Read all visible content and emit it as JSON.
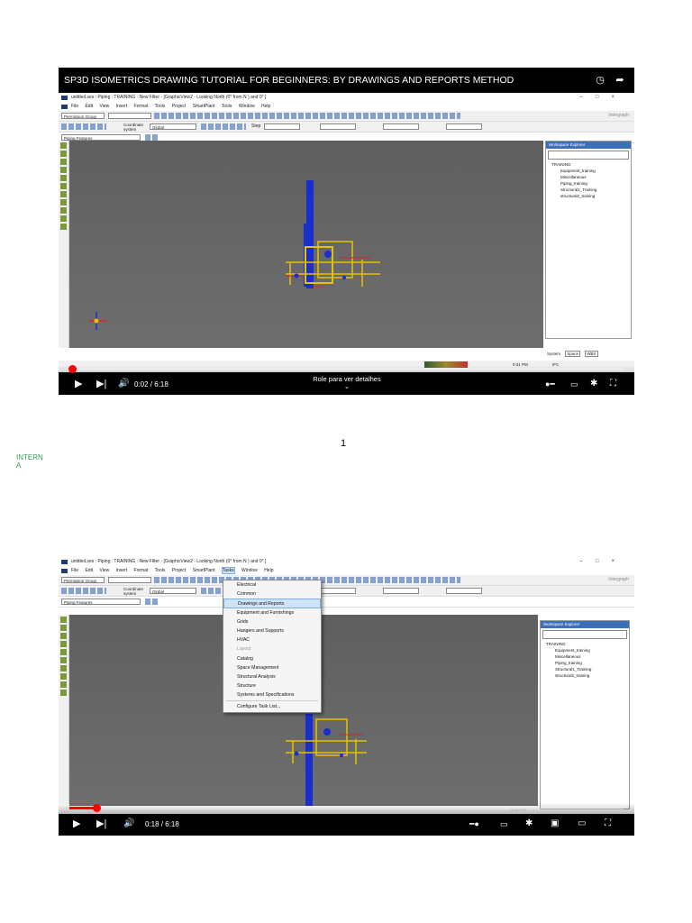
{
  "video1": {
    "title": "SP3D ISOMETRICS DRAWING TUTORIAL FOR BEGINNERS: BY DRAWINGS AND REPORTS METHOD",
    "progress": 0.005,
    "time": "0:02 / 6:18",
    "hint": "Role para ver detalhes",
    "hint_arrow": "⌄"
  },
  "app": {
    "window_title": "untitled.ses : Piping : TRAINING : New Filter - [GraphicView2 - Looking North (0° from N ) and 0° ]",
    "menu": [
      "File",
      "Edit",
      "View",
      "Insert",
      "Format",
      "Tools",
      "Project",
      "SmartPlant",
      "Tools",
      "Window",
      "Help"
    ],
    "menu2": [
      "File",
      "Edit",
      "View",
      "Insert",
      "Format",
      "Tools",
      "Project",
      "SmartPlant",
      "Tasks",
      "Window",
      "Help"
    ],
    "permission_group": "Permission Group",
    "coordinate_label": "Coordinate system",
    "coordinate_value": "Global",
    "step_label": "Step",
    "piping_features": "Piping Features",
    "brand": "Intergraph",
    "explorer_title": "Workspace Explorer",
    "tree_root": "TRAINING",
    "tree_items": [
      "Equipment_training",
      "Miscellaneous",
      "Piping_training",
      "Structural1_Training",
      "structural2_training"
    ],
    "tabs": [
      "System",
      "Space",
      "WBS"
    ],
    "status_time": "9:31 PM",
    "status_ifc": "IFC"
  },
  "video2": {
    "progress": 0.048,
    "time": "0:18 / 6:18",
    "status_time": "9:31 PM",
    "tasks_menu": [
      "Electrical",
      "Common",
      "Drawings and Reports",
      "Equipment and Furnishings",
      "Grids",
      "Hangers and Supports",
      "HVAC",
      "Layout",
      "Catalog",
      "Space Management",
      "Structural Analysis",
      "Structure",
      "Systems and Specifications",
      "Configure Task List..."
    ]
  },
  "page": {
    "number": "1",
    "classification": "INTERN\nA"
  },
  "colors": {
    "youtube_red": "#ff0000",
    "pipe_blue": "#1a2ecc",
    "struct_yellow": "#e6c200",
    "accent_red": "#e02020"
  }
}
